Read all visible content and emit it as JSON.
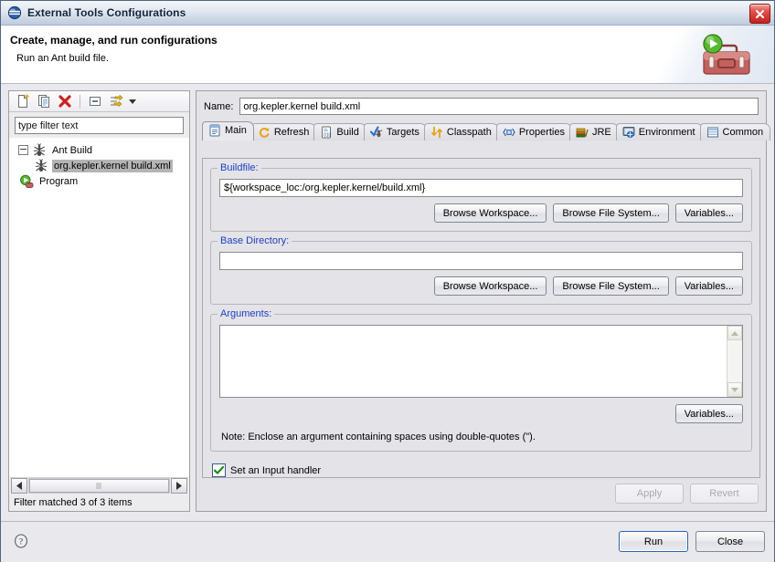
{
  "window": {
    "title": "External Tools Configurations",
    "icon": "eclipse-globe-icon",
    "close_label": "✕"
  },
  "header": {
    "title": "Create, manage, and run configurations",
    "subtitle": "Run an Ant build file.",
    "icon": "toolbox-with-run-icon"
  },
  "left_panel": {
    "toolbar": [
      {
        "name": "new-configuration-button",
        "icon": "new-document-icon",
        "tooltip": "New launch configuration"
      },
      {
        "name": "duplicate-configuration-button",
        "icon": "copy-pages-icon",
        "tooltip": "Duplicate"
      },
      {
        "name": "delete-configuration-button",
        "icon": "red-x-icon",
        "tooltip": "Delete"
      },
      {
        "name": "collapse-all-button",
        "icon": "collapse-all-icon",
        "tooltip": "Collapse All"
      },
      {
        "name": "filter-configurations-button",
        "icon": "filter-arrows-icon",
        "tooltip": "Filter"
      }
    ],
    "filter": {
      "value": "",
      "placeholder": "type filter text"
    },
    "tree": [
      {
        "label": "Ant Build",
        "icon": "ant-icon",
        "level": 0,
        "expanded": true,
        "selected": false
      },
      {
        "label": "org.kepler.kernel build.xml",
        "icon": "ant-icon",
        "level": 1,
        "expanded": null,
        "selected": true
      },
      {
        "label": "Program",
        "icon": "program-run-icon",
        "level": 0,
        "expanded": null,
        "selected": false
      }
    ],
    "status": "Filter matched 3 of 3 items",
    "scrollbar": {
      "left_arrow": "◀",
      "right_arrow": "▶"
    }
  },
  "right_panel": {
    "name_label": "Name:",
    "name_value": "org.kepler.kernel build.xml",
    "tabs": [
      {
        "label": "Main",
        "icon": "main-document-icon",
        "active": true
      },
      {
        "label": "Refresh",
        "icon": "refresh-arrows-icon",
        "active": false
      },
      {
        "label": "Build",
        "icon": "build-binary-icon",
        "active": false
      },
      {
        "label": "Targets",
        "icon": "targets-check-icon",
        "active": false
      },
      {
        "label": "Classpath",
        "icon": "classpath-arrows-icon",
        "active": false
      },
      {
        "label": "Properties",
        "icon": "properties-icon",
        "active": false
      },
      {
        "label": "JRE",
        "icon": "jre-books-icon",
        "active": false
      },
      {
        "label": "Environment",
        "icon": "environment-icon",
        "active": false
      },
      {
        "label": "Common",
        "icon": "common-table-icon",
        "active": false
      }
    ],
    "buildfile": {
      "legend": "Buildfile:",
      "value": "${workspace_loc:/org.kepler.kernel/build.xml}",
      "browse_workspace": "Browse Workspace...",
      "browse_file_system": "Browse File System...",
      "variables": "Variables..."
    },
    "base_directory": {
      "legend": "Base Directory:",
      "value": "",
      "browse_workspace": "Browse Workspace...",
      "browse_file_system": "Browse File System...",
      "variables": "Variables..."
    },
    "arguments": {
      "legend": "Arguments:",
      "value": "",
      "variables": "Variables...",
      "note": "Note: Enclose an argument containing spaces using double-quotes (\")."
    },
    "input_handler": {
      "label": "Set an Input handler",
      "checked": true
    },
    "apply_label": "Apply",
    "apply_enabled": false,
    "revert_label": "Revert",
    "revert_enabled": false
  },
  "footer": {
    "help_icon": "help-question-icon",
    "run_label": "Run",
    "close_label": "Close"
  },
  "colors": {
    "group_legend": "#1d3fbf",
    "dialog_bg": "#e3e3e8",
    "titlebar_from": "#f2f5f9",
    "titlebar_to": "#bfccdd",
    "close_button": "#c4221c",
    "selection": "#b4b4b4",
    "default_button_border": "#2b63b5",
    "checkmark": "#108a10"
  }
}
